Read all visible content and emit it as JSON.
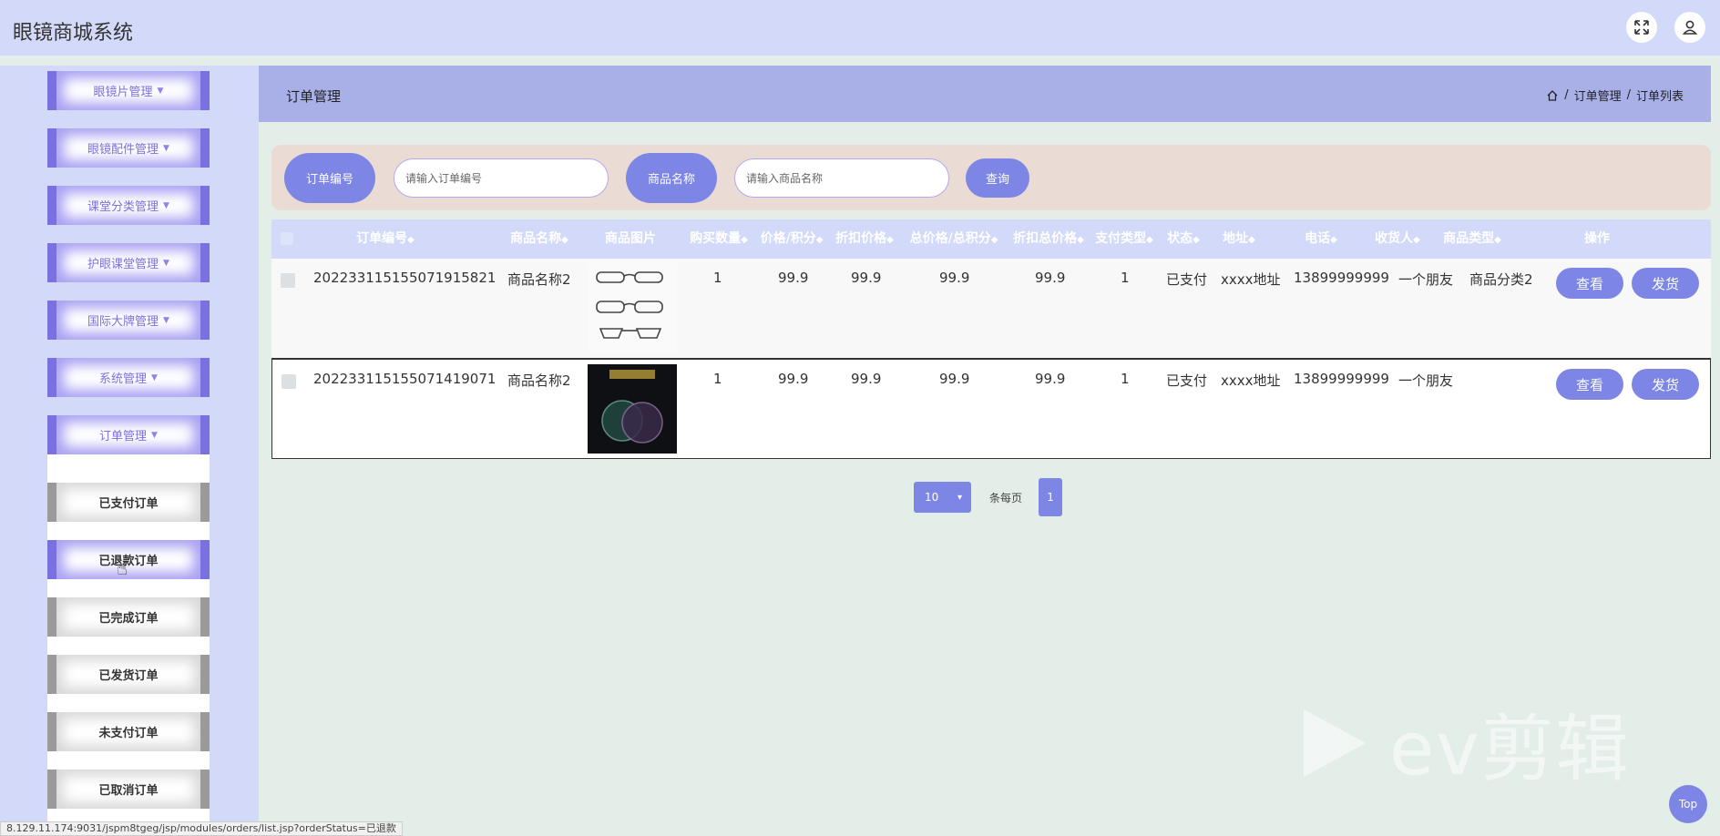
{
  "app": {
    "title": "眼镜商城系统"
  },
  "sidebar": {
    "menus": [
      {
        "label": "眼镜片管理"
      },
      {
        "label": "眼镜配件管理"
      },
      {
        "label": "课堂分类管理"
      },
      {
        "label": "护眼课堂管理"
      },
      {
        "label": "国际大牌管理"
      },
      {
        "label": "系统管理"
      },
      {
        "label": "订单管理"
      }
    ],
    "order_submenu": [
      {
        "label": "已支付订单"
      },
      {
        "label": "已退款订单"
      },
      {
        "label": "已完成订单"
      },
      {
        "label": "已发货订单"
      },
      {
        "label": "未支付订单"
      },
      {
        "label": "已取消订单"
      }
    ]
  },
  "header": {
    "section_title": "订单管理",
    "breadcrumb": [
      "订单管理",
      "订单列表"
    ],
    "breadcrumb_sep": "/"
  },
  "search": {
    "order_label": "订单编号",
    "order_placeholder": "请输入订单编号",
    "product_label": "商品名称",
    "product_placeholder": "请输入商品名称",
    "query_label": "查询"
  },
  "table": {
    "headers": [
      "订单编号",
      "商品名称",
      "商品图片",
      "购买数量",
      "价格/积分",
      "折扣价格",
      "总价格/总积分",
      "折扣总价格",
      "支付类型",
      "状态",
      "地址",
      "电话",
      "收货人",
      "商品类型",
      "操作"
    ],
    "rows": [
      {
        "order_no": "202233115155071915821",
        "name": "商品名称2",
        "qty": "1",
        "price": "99.9",
        "discount": "99.9",
        "total": "99.9",
        "discount_total": "99.9",
        "pay_type": "1",
        "status": "已支付",
        "address": "xxxx地址",
        "phone": "13899999999",
        "receiver": "一个朋友",
        "category": "商品分类2",
        "view": "查看",
        "ship": "发货"
      },
      {
        "order_no": "202233115155071419071",
        "name": "商品名称2",
        "qty": "1",
        "price": "99.9",
        "discount": "99.9",
        "total": "99.9",
        "discount_total": "99.9",
        "pay_type": "1",
        "status": "已支付",
        "address": "xxxx地址",
        "phone": "13899999999",
        "receiver": "一个朋友",
        "category": "",
        "view": "查看",
        "ship": "发货"
      }
    ]
  },
  "pagination": {
    "page_size": "10",
    "per_page_text": "条每页",
    "current_page": "1"
  },
  "watermark": {
    "text": "ev剪辑"
  },
  "status_bar": {
    "url": "8.129.11.174:9031/jspm8tgeg/jsp/modules/orders/list.jsp?orderStatus=已退款"
  },
  "back_to_top": {
    "label": "Top"
  },
  "colors": {
    "accent": "#7d86e5",
    "sidebar": "#d3daf9",
    "menu_border": "#7a70e0",
    "header": "#a9b0e8",
    "search_bg": "#eadcd5"
  }
}
